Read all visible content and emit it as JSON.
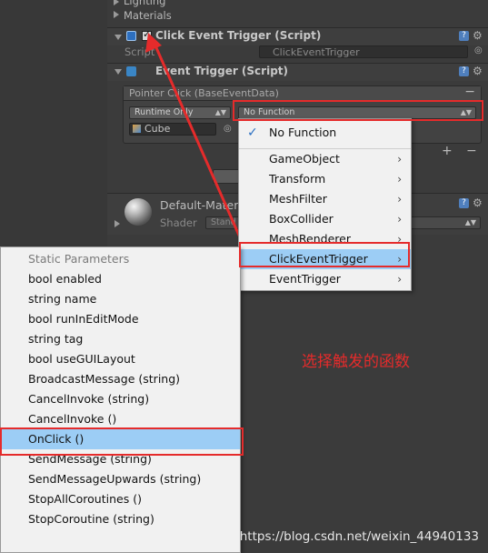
{
  "sections": {
    "lighting": "Lighting",
    "materials": "Materials"
  },
  "click_event_trigger": {
    "title": "Click Event Trigger (Script)",
    "script_label": "Script",
    "script_value": "ClickEventTrigger"
  },
  "event_trigger": {
    "title": "Event Trigger (Script)",
    "event_header": "Pointer Click (BaseEventData)",
    "runtime_dropdown": "Runtime Only",
    "function_dropdown": "No Function",
    "object_field": "Cube",
    "minus": "−",
    "plus": "+"
  },
  "material": {
    "name": "Default-Mater",
    "shader_label": "Shader",
    "shader_value": "Stand"
  },
  "function_menu": {
    "no_function": "No Function",
    "items": [
      "GameObject",
      "Transform",
      "MeshFilter",
      "BoxCollider",
      "MeshRenderer",
      "ClickEventTrigger",
      "EventTrigger"
    ]
  },
  "submenu": {
    "header": "Static Parameters",
    "items": [
      "bool enabled",
      "string name",
      "bool runInEditMode",
      "string tag",
      "bool useGUILayout",
      "BroadcastMessage (string)",
      "CancelInvoke (string)",
      "CancelInvoke ()",
      "OnClick ()",
      "SendMessage (string)",
      "SendMessageUpwards (string)",
      "StopAllCoroutines ()",
      "StopCoroutine (string)"
    ]
  },
  "annotation": "选择触发的函数",
  "watermark": "https://blog.csdn.net/weixin_44940133",
  "colors": {
    "annotation_red": "#e52b2b",
    "highlight_blue": "#9ccdf5",
    "menu_bg": "#f1f1f1",
    "inspector_bg": "#3b3b3b"
  },
  "icons": [
    "help-icon",
    "gear-icon",
    "checkbox-icon",
    "check-icon",
    "chevron-right-icon",
    "cube-icon",
    "foldout-arrow-icon",
    "script-icon"
  ]
}
